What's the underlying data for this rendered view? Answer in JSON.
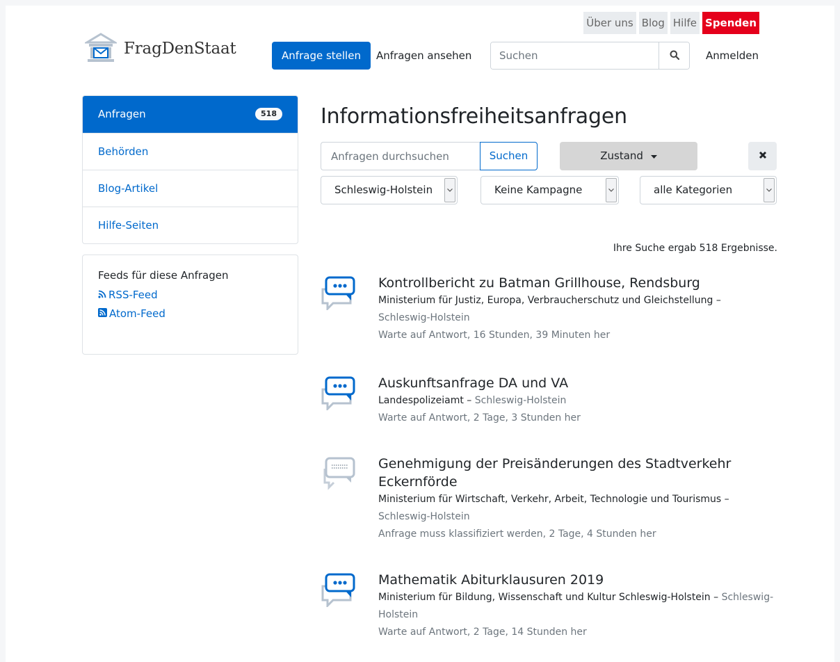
{
  "top_links": {
    "about": "Über uns",
    "blog": "Blog",
    "help": "Hilfe",
    "donate": "Spenden"
  },
  "header": {
    "logo_text": "FragDenStaat",
    "make_request": "Anfrage stellen",
    "view_requests": "Anfragen ansehen",
    "search_placeholder": "Suchen",
    "login": "Anmelden"
  },
  "sidebar": {
    "items": [
      {
        "label": "Anfragen",
        "badge": "518"
      },
      {
        "label": "Behörden"
      },
      {
        "label": "Blog-Artikel"
      },
      {
        "label": "Hilfe-Seiten"
      }
    ]
  },
  "feeds": {
    "title": "Feeds für diese Anfragen",
    "rss": "RSS-Feed",
    "atom": "Atom-Feed"
  },
  "main": {
    "title": "Informationsfreiheitsanfragen",
    "filter_placeholder": "Anfragen durchsuchen",
    "filter_button": "Suchen",
    "status_button": "Zustand",
    "selects": [
      "Schleswig-Holstein",
      "Keine Kampagne",
      "alle Kategorien"
    ],
    "results_count": "Ihre Suche ergab 518 Ergebnisse."
  },
  "results": [
    {
      "title": "Kontrollbericht zu Batman Grillhouse, Rendsburg",
      "authority": "Ministerium für Justiz, Europa, Verbraucherschutz und Gleichstellung",
      "region": "Schleswig-Holstein",
      "status": "Warte auf Antwort, 16 Stunden, 39 Minuten her"
    },
    {
      "title": "Auskunftsanfrage DA und VA",
      "authority": "Landespolizeiamt",
      "region": "Schleswig-Holstein",
      "status": "Warte auf Antwort, 2 Tage, 3 Stunden her"
    },
    {
      "title": "Genehmigung der Preisänderungen des Stadtverkehr Eckernförde",
      "authority": "Ministerium für Wirtschaft, Verkehr, Arbeit, Technologie und Tourismus",
      "region": "Schleswig-Holstein",
      "status": "Anfrage muss klassifiziert werden, 2 Tage, 4 Stunden her"
    },
    {
      "title": "Mathematik Abiturklausuren 2019",
      "authority": "Ministerium für Bildung, Wissenschaft und Kultur Schleswig-Holstein",
      "region": "Schleswig-Holstein",
      "status": "Warte auf Antwort, 2 Tage, 14 Stunden her"
    }
  ],
  "colors": {
    "primary": "#0069cc",
    "donate": "#e5001b",
    "muted": "#6c757d"
  }
}
